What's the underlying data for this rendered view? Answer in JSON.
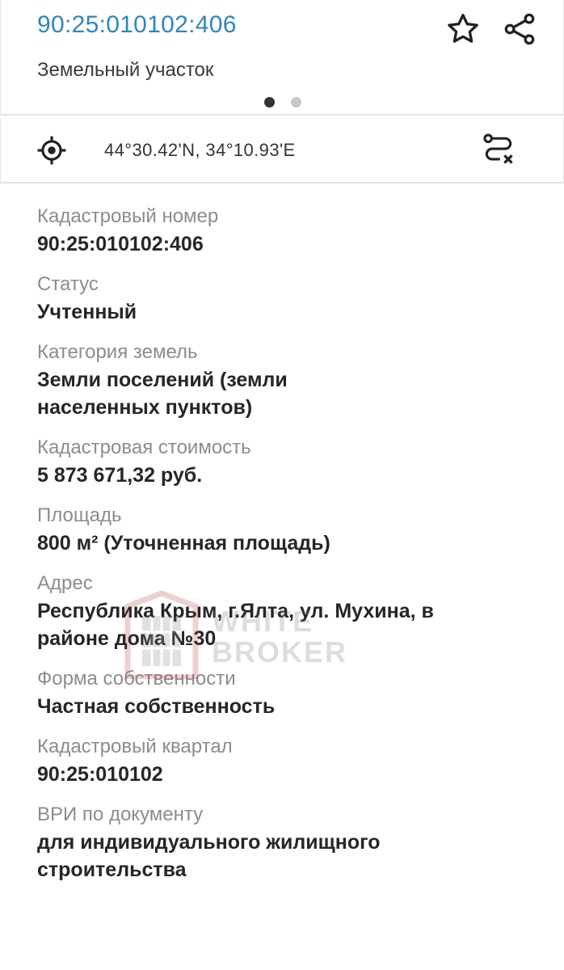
{
  "header": {
    "cadastral_link": "90:25:010102:406",
    "object_type": "Земельный участок",
    "favorite_icon": "star-outline-icon",
    "share_icon": "share-icon"
  },
  "pager": {
    "pages": 2,
    "active": 1
  },
  "coords": {
    "text": "44°30.42'N, 34°10.93'E",
    "locate_icon": "crosshair-icon",
    "route_icon": "route-cancel-icon"
  },
  "properties": [
    {
      "label": "Кадастровый номер",
      "value": "90:25:010102:406"
    },
    {
      "label": "Статус",
      "value": "Учтенный"
    },
    {
      "label": "Категория земель",
      "value": "Земли поселений (земли населенных пунктов)"
    },
    {
      "label": "Кадастровая стоимость",
      "value": "5 873 671,32 руб."
    },
    {
      "label": "Площадь",
      "value": "800 м² (Уточненная площадь)"
    },
    {
      "label": "Адрес",
      "value": "Республика Крым, г.Ялта,  ул. Мухина, в районе дома №30"
    },
    {
      "label": "Форма собственности",
      "value": "Частная собственность"
    },
    {
      "label": "Кадастровый квартал",
      "value": "90:25:010102"
    },
    {
      "label": "ВРИ по документу",
      "value": "для индивидуального жилищного строительства"
    }
  ],
  "watermark": {
    "line1": "WHITE",
    "line2": "BROKER"
  },
  "colors": {
    "link": "#2e86c1",
    "label": "#8c8c8c",
    "value": "#262626",
    "divider": "#e3e3e3"
  }
}
